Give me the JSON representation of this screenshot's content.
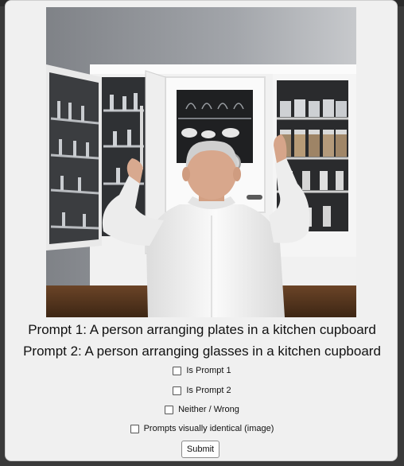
{
  "prompts": {
    "prompt1": "Prompt 1: A person arranging plates in a kitchen cupboard",
    "prompt2": "Prompt 2: A person arranging glasses in a kitchen cupboard"
  },
  "options": {
    "is_prompt_1": "Is Prompt 1",
    "is_prompt_2": "Is Prompt 2",
    "neither": "Neither / Wrong",
    "identical": "Prompts visually identical (image)"
  },
  "submit_label": "Submit",
  "image": {
    "subject": "man-with-white-shirt-at-kitchen-cupboard",
    "colors": {
      "wall": "#8e9196",
      "cabinet": "#f3f3f3",
      "shirt": "#f7f7f7",
      "countertop": "#5a3a22"
    }
  }
}
